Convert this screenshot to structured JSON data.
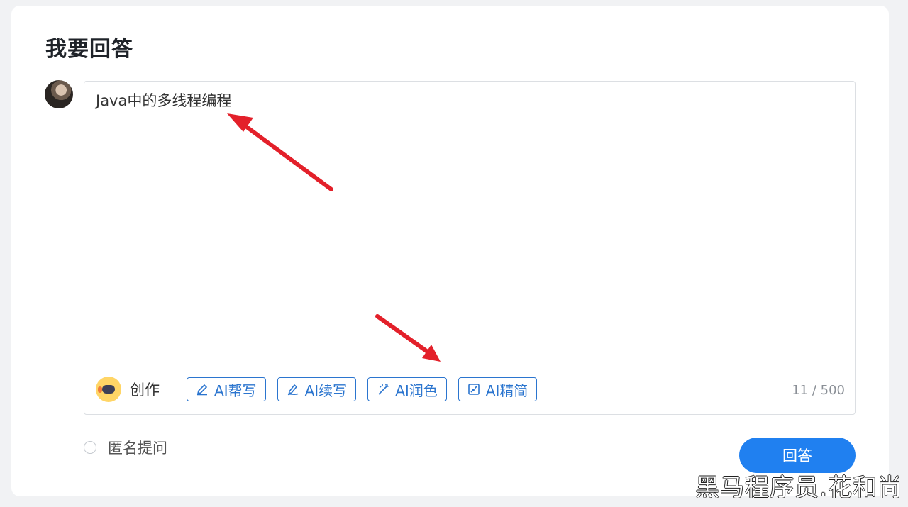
{
  "page": {
    "title": "我要回答"
  },
  "editor": {
    "content": "Java中的多线程编程",
    "counter": "11 / 500"
  },
  "toolbar": {
    "create_label": "创作",
    "buttons": [
      {
        "label": "AI帮写",
        "icon": "pen-icon"
      },
      {
        "label": "AI续写",
        "icon": "write-continue-icon"
      },
      {
        "label": "AI润色",
        "icon": "magic-wand-icon"
      },
      {
        "label": "AI精简",
        "icon": "compress-icon"
      }
    ]
  },
  "options": {
    "anonymous_label": "匿名提问"
  },
  "actions": {
    "submit_label": "回答"
  },
  "watermark": {
    "text": "黑马程序员.花和尚"
  },
  "colors": {
    "accent": "#2080f0",
    "ai_button": "#2b75cf",
    "annotation_arrow": "#e3202a"
  }
}
